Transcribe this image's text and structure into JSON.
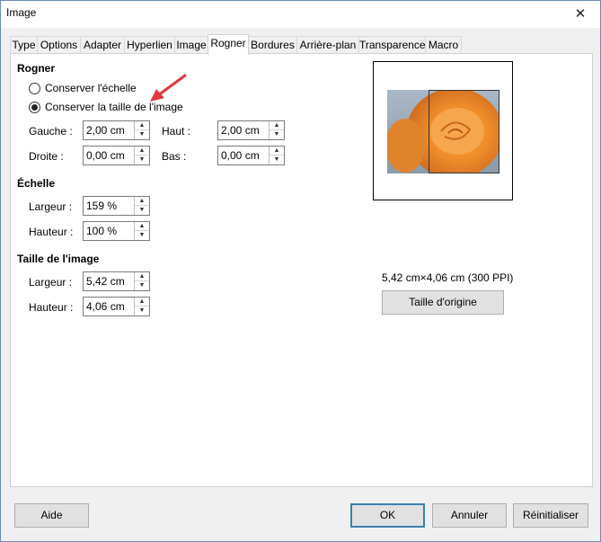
{
  "window": {
    "title": "Image",
    "close_glyph": "✕"
  },
  "tabs": [
    {
      "label": "Type"
    },
    {
      "label": "Options"
    },
    {
      "label": "Adapter"
    },
    {
      "label": "Hyperlien"
    },
    {
      "label": "Image"
    },
    {
      "label": "Rogner"
    },
    {
      "label": "Bordures"
    },
    {
      "label": "Arrière-plan"
    },
    {
      "label": "Transparence"
    },
    {
      "label": "Macro"
    }
  ],
  "active_tab": "Rogner",
  "crop": {
    "title": "Rogner",
    "keep_scale_label": "Conserver l'échelle",
    "keep_size_label": "Conserver la taille de l'image",
    "selected_option": "keep_size",
    "left_label": "Gauche :",
    "left_value": "2,00 cm",
    "top_label": "Haut :",
    "top_value": "2,00 cm",
    "right_label": "Droite :",
    "right_value": "0,00 cm",
    "bottom_label": "Bas :",
    "bottom_value": "0,00 cm"
  },
  "scale": {
    "title": "Échelle",
    "width_label": "Largeur :",
    "width_value": "159 %",
    "height_label": "Hauteur :",
    "height_value": "100 %"
  },
  "image_size": {
    "title": "Taille de l'image",
    "width_label": "Largeur :",
    "width_value": "5,42 cm",
    "height_label": "Hauteur :",
    "height_value": "4,06 cm"
  },
  "preview": {
    "info_text": "5,42 cm×4,06 cm (300 PPI)",
    "original_size_button": "Taille d'origine"
  },
  "footer": {
    "help_button": "Aide",
    "ok_button": "OK",
    "cancel_button": "Annuler",
    "reset_button": "Réinitialiser"
  },
  "icons": {
    "spin_up": "▲",
    "spin_down": "▼",
    "arrow_color": "#e0393e",
    "focus_color": "#3c7fb1"
  }
}
